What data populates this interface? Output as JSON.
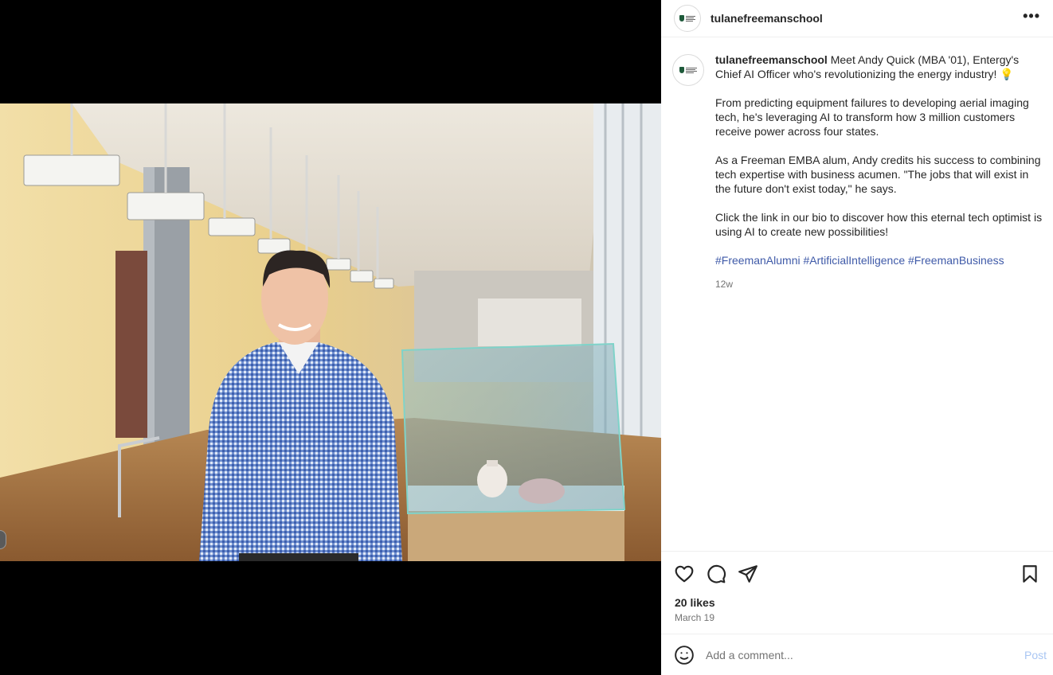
{
  "post": {
    "username": "tulanefreemanschool",
    "more_icon": "•••",
    "caption_intro": "Meet Andy Quick (MBA '01), Entergy's Chief AI Officer who's revolutionizing the energy industry! 💡",
    "caption_p2": "From predicting equipment failures to developing aerial imaging tech, he's leveraging AI to transform how 3 million customers receive power across four states.",
    "caption_p3": "As a Freeman EMBA alum, Andy credits his success to combining tech expertise with business acumen. \"The jobs that will exist in the future don't exist today,\" he says.",
    "caption_p4": "Click the link in our bio to discover how this eternal tech optimist is using AI to create new possibilities!",
    "hashtags": [
      "#FreemanAlumni",
      "#ArtificialIntelligence",
      "#FreemanBusiness"
    ],
    "age": "12w",
    "likes": "20 likes",
    "date": "March 19"
  },
  "comment": {
    "placeholder": "Add a comment...",
    "post_label": "Post"
  },
  "icons": {
    "like": "heart-icon",
    "comment": "comment-icon",
    "share": "share-icon",
    "save": "bookmark-icon",
    "emoji": "emoji-icon",
    "more": "more-icon"
  },
  "colors": {
    "hashtag": "#3f5aa8",
    "post_button": "#a9c6f3",
    "brand_green": "#1e5a3a"
  }
}
